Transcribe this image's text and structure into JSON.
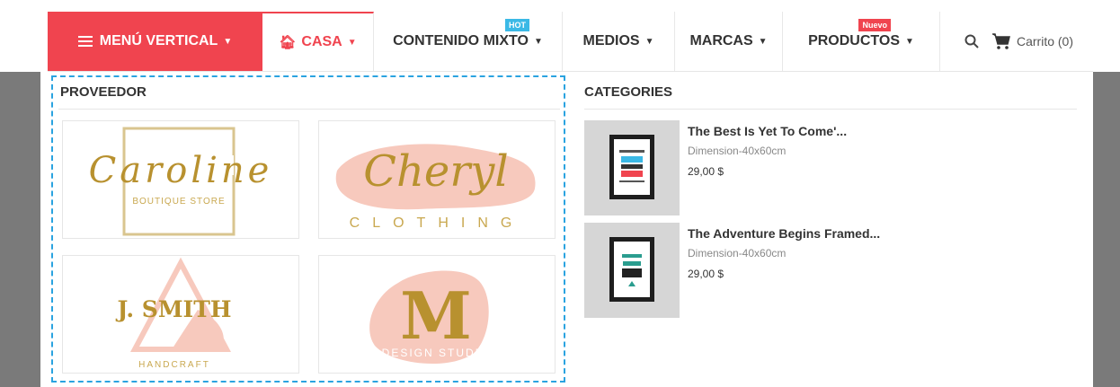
{
  "nav": {
    "vertical_menu": "MENÚ VERTICAL",
    "home": "CASA",
    "mixed": "CONTENIDO MIXTO",
    "mixed_badge": "HOT",
    "media": "MEDIOS",
    "brands": "MARCAS",
    "products": "PRODUCTOS",
    "products_badge": "Nuevo",
    "cart": "Carrito (0)"
  },
  "suppliers": {
    "title": "PROVEEDOR",
    "logos": [
      {
        "name": "Caroline",
        "tagline": "BOUTIQUE STORE"
      },
      {
        "name": "Cheryl",
        "tagline": "CLOTHING"
      },
      {
        "name": "J. SMITH",
        "tagline": "HANDCRAFT"
      },
      {
        "name": "M",
        "tagline": "DESIGN STUDIO"
      }
    ]
  },
  "categories": {
    "title": "CATEGORIES",
    "products": [
      {
        "name": "The Best Is Yet To Come'...",
        "dimension": "Dimension-40x60cm",
        "price": "29,00 $"
      },
      {
        "name": "The Adventure Begins Framed...",
        "dimension": "Dimension-40x60cm",
        "price": "29,00 $"
      }
    ]
  },
  "colors": {
    "accent": "#f0444f",
    "hot": "#3bb9e6",
    "logo_gold": "#b8912f",
    "logo_pink": "#f7c9bd"
  }
}
